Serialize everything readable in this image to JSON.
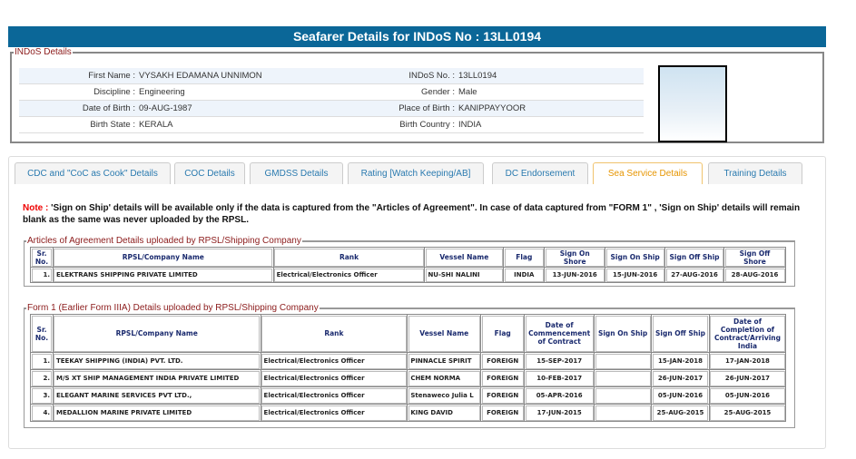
{
  "header": {
    "title": "Seafarer Details for INDoS No : 13LL0194"
  },
  "indos": {
    "legend": "INDoS Details",
    "rows": [
      [
        {
          "label": "First Name :",
          "value": "VYSAKH EDAMANA UNNIMON"
        },
        {
          "label": "INDoS No. :",
          "value": "13LL0194"
        }
      ],
      [
        {
          "label": "Discipline :",
          "value": "Engineering"
        },
        {
          "label": "Gender :",
          "value": "Male"
        }
      ],
      [
        {
          "label": "Date of Birth :",
          "value": "09-AUG-1987"
        },
        {
          "label": "Place of Birth :",
          "value": "KANIPPAYYOOR"
        }
      ],
      [
        {
          "label": "Birth State :",
          "value": "KERALA"
        },
        {
          "label": "Birth Country :",
          "value": "INDIA"
        }
      ]
    ]
  },
  "tabs": [
    "CDC and \"CoC as Cook\" Details",
    "COC Details",
    "GMDSS Details",
    "Rating [Watch Keeping/AB]",
    "DC Endorsement",
    "Sea Service Details",
    "Training Details"
  ],
  "note": {
    "label": "Note :",
    "text": " 'Sign on Ship' details will be available only if the data is captured from the \"Articles of Agreement\". In case of data captured from \"FORM 1\" , 'Sign on Ship' details will remain blank as the same was never uploaded by the RPSL."
  },
  "aoa": {
    "legend": "Articles of Agreement Details uploaded by RPSL/Shipping Company",
    "headers": [
      "Sr. No.",
      "RPSL/Company Name",
      "Rank",
      "Vessel Name",
      "Flag",
      "Sign On Shore",
      "Sign On Ship",
      "Sign Off Ship",
      "Sign Off Shore"
    ],
    "rows": [
      [
        "1.",
        "ELEKTRANS SHIPPING PRIVATE LIMITED",
        "Electrical/Electronics Officer",
        "NU-SHI NALINI",
        "INDIA",
        "13-JUN-2016",
        "15-JUN-2016",
        "27-AUG-2016",
        "28-AUG-2016"
      ]
    ]
  },
  "form1": {
    "legend": "Form 1 (Earlier Form IIIA) Details uploaded by RPSL/Shipping Company",
    "headers": [
      "Sr. No.",
      "RPSL/Company Name",
      "Rank",
      "Vessel Name",
      "Flag",
      "Date of Commencement of Contract",
      "Sign On Ship",
      "Sign Off Ship",
      "Date of Completion of Contract/Arriving India"
    ],
    "rows": [
      [
        "1.",
        "TEEKAY SHIPPING (INDIA) PVT. LTD.",
        "Electrical/Electronics Officer",
        "PINNACLE SPIRIT",
        "FOREIGN",
        "15-SEP-2017",
        "",
        "15-JAN-2018",
        "17-JAN-2018"
      ],
      [
        "2.",
        "M/S XT SHIP MANAGEMENT INDIA PRIVATE LIMITED",
        "Electrical/Electronics Officer",
        "CHEM NORMA",
        "FOREIGN",
        "10-FEB-2017",
        "",
        "26-JUN-2017",
        "26-JUN-2017"
      ],
      [
        "3.",
        "ELEGANT MARINE SERVICES PVT LTD.,",
        "Electrical/Electronics Officer",
        "Stenaweco Julia L",
        "FOREIGN",
        "05-APR-2016",
        "",
        "05-JUN-2016",
        "05-JUN-2016"
      ],
      [
        "4.",
        "MEDALLION MARINE PRIVATE LIMITED",
        "Electrical/Electronics Officer",
        "KING DAVID",
        "FOREIGN",
        "17-JUN-2015",
        "",
        "25-AUG-2015",
        "25-AUG-2015"
      ]
    ]
  }
}
